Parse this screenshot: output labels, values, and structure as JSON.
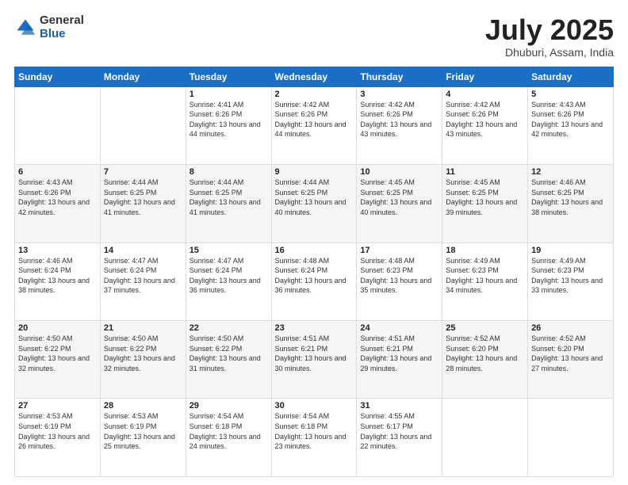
{
  "logo": {
    "general": "General",
    "blue": "Blue"
  },
  "header": {
    "title": "July 2025",
    "subtitle": "Dhuburi, Assam, India"
  },
  "days_of_week": [
    "Sunday",
    "Monday",
    "Tuesday",
    "Wednesday",
    "Thursday",
    "Friday",
    "Saturday"
  ],
  "weeks": [
    [
      {
        "day": "",
        "sunrise": "",
        "sunset": "",
        "daylight": ""
      },
      {
        "day": "",
        "sunrise": "",
        "sunset": "",
        "daylight": ""
      },
      {
        "day": "1",
        "sunrise": "Sunrise: 4:41 AM",
        "sunset": "Sunset: 6:26 PM",
        "daylight": "Daylight: 13 hours and 44 minutes."
      },
      {
        "day": "2",
        "sunrise": "Sunrise: 4:42 AM",
        "sunset": "Sunset: 6:26 PM",
        "daylight": "Daylight: 13 hours and 44 minutes."
      },
      {
        "day": "3",
        "sunrise": "Sunrise: 4:42 AM",
        "sunset": "Sunset: 6:26 PM",
        "daylight": "Daylight: 13 hours and 43 minutes."
      },
      {
        "day": "4",
        "sunrise": "Sunrise: 4:42 AM",
        "sunset": "Sunset: 6:26 PM",
        "daylight": "Daylight: 13 hours and 43 minutes."
      },
      {
        "day": "5",
        "sunrise": "Sunrise: 4:43 AM",
        "sunset": "Sunset: 6:26 PM",
        "daylight": "Daylight: 13 hours and 42 minutes."
      }
    ],
    [
      {
        "day": "6",
        "sunrise": "Sunrise: 4:43 AM",
        "sunset": "Sunset: 6:26 PM",
        "daylight": "Daylight: 13 hours and 42 minutes."
      },
      {
        "day": "7",
        "sunrise": "Sunrise: 4:44 AM",
        "sunset": "Sunset: 6:25 PM",
        "daylight": "Daylight: 13 hours and 41 minutes."
      },
      {
        "day": "8",
        "sunrise": "Sunrise: 4:44 AM",
        "sunset": "Sunset: 6:25 PM",
        "daylight": "Daylight: 13 hours and 41 minutes."
      },
      {
        "day": "9",
        "sunrise": "Sunrise: 4:44 AM",
        "sunset": "Sunset: 6:25 PM",
        "daylight": "Daylight: 13 hours and 40 minutes."
      },
      {
        "day": "10",
        "sunrise": "Sunrise: 4:45 AM",
        "sunset": "Sunset: 6:25 PM",
        "daylight": "Daylight: 13 hours and 40 minutes."
      },
      {
        "day": "11",
        "sunrise": "Sunrise: 4:45 AM",
        "sunset": "Sunset: 6:25 PM",
        "daylight": "Daylight: 13 hours and 39 minutes."
      },
      {
        "day": "12",
        "sunrise": "Sunrise: 4:46 AM",
        "sunset": "Sunset: 6:25 PM",
        "daylight": "Daylight: 13 hours and 38 minutes."
      }
    ],
    [
      {
        "day": "13",
        "sunrise": "Sunrise: 4:46 AM",
        "sunset": "Sunset: 6:24 PM",
        "daylight": "Daylight: 13 hours and 38 minutes."
      },
      {
        "day": "14",
        "sunrise": "Sunrise: 4:47 AM",
        "sunset": "Sunset: 6:24 PM",
        "daylight": "Daylight: 13 hours and 37 minutes."
      },
      {
        "day": "15",
        "sunrise": "Sunrise: 4:47 AM",
        "sunset": "Sunset: 6:24 PM",
        "daylight": "Daylight: 13 hours and 36 minutes."
      },
      {
        "day": "16",
        "sunrise": "Sunrise: 4:48 AM",
        "sunset": "Sunset: 6:24 PM",
        "daylight": "Daylight: 13 hours and 36 minutes."
      },
      {
        "day": "17",
        "sunrise": "Sunrise: 4:48 AM",
        "sunset": "Sunset: 6:23 PM",
        "daylight": "Daylight: 13 hours and 35 minutes."
      },
      {
        "day": "18",
        "sunrise": "Sunrise: 4:49 AM",
        "sunset": "Sunset: 6:23 PM",
        "daylight": "Daylight: 13 hours and 34 minutes."
      },
      {
        "day": "19",
        "sunrise": "Sunrise: 4:49 AM",
        "sunset": "Sunset: 6:23 PM",
        "daylight": "Daylight: 13 hours and 33 minutes."
      }
    ],
    [
      {
        "day": "20",
        "sunrise": "Sunrise: 4:50 AM",
        "sunset": "Sunset: 6:22 PM",
        "daylight": "Daylight: 13 hours and 32 minutes."
      },
      {
        "day": "21",
        "sunrise": "Sunrise: 4:50 AM",
        "sunset": "Sunset: 6:22 PM",
        "daylight": "Daylight: 13 hours and 32 minutes."
      },
      {
        "day": "22",
        "sunrise": "Sunrise: 4:50 AM",
        "sunset": "Sunset: 6:22 PM",
        "daylight": "Daylight: 13 hours and 31 minutes."
      },
      {
        "day": "23",
        "sunrise": "Sunrise: 4:51 AM",
        "sunset": "Sunset: 6:21 PM",
        "daylight": "Daylight: 13 hours and 30 minutes."
      },
      {
        "day": "24",
        "sunrise": "Sunrise: 4:51 AM",
        "sunset": "Sunset: 6:21 PM",
        "daylight": "Daylight: 13 hours and 29 minutes."
      },
      {
        "day": "25",
        "sunrise": "Sunrise: 4:52 AM",
        "sunset": "Sunset: 6:20 PM",
        "daylight": "Daylight: 13 hours and 28 minutes."
      },
      {
        "day": "26",
        "sunrise": "Sunrise: 4:52 AM",
        "sunset": "Sunset: 6:20 PM",
        "daylight": "Daylight: 13 hours and 27 minutes."
      }
    ],
    [
      {
        "day": "27",
        "sunrise": "Sunrise: 4:53 AM",
        "sunset": "Sunset: 6:19 PM",
        "daylight": "Daylight: 13 hours and 26 minutes."
      },
      {
        "day": "28",
        "sunrise": "Sunrise: 4:53 AM",
        "sunset": "Sunset: 6:19 PM",
        "daylight": "Daylight: 13 hours and 25 minutes."
      },
      {
        "day": "29",
        "sunrise": "Sunrise: 4:54 AM",
        "sunset": "Sunset: 6:18 PM",
        "daylight": "Daylight: 13 hours and 24 minutes."
      },
      {
        "day": "30",
        "sunrise": "Sunrise: 4:54 AM",
        "sunset": "Sunset: 6:18 PM",
        "daylight": "Daylight: 13 hours and 23 minutes."
      },
      {
        "day": "31",
        "sunrise": "Sunrise: 4:55 AM",
        "sunset": "Sunset: 6:17 PM",
        "daylight": "Daylight: 13 hours and 22 minutes."
      },
      {
        "day": "",
        "sunrise": "",
        "sunset": "",
        "daylight": ""
      },
      {
        "day": "",
        "sunrise": "",
        "sunset": "",
        "daylight": ""
      }
    ]
  ]
}
